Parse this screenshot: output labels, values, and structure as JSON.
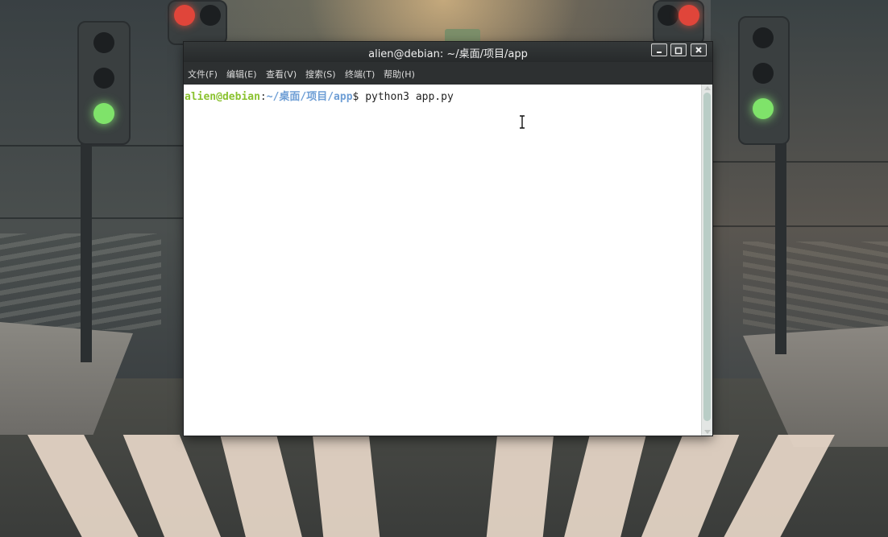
{
  "window": {
    "title": "alien@debian: ~/桌面/项目/app",
    "controls": {
      "minimize_icon": "minimize-icon",
      "maximize_icon": "maximize-icon",
      "close_icon": "close-icon"
    }
  },
  "menubar": {
    "items": [
      {
        "label": "文件(F)"
      },
      {
        "label": "编辑(E)"
      },
      {
        "label": "查看(V)"
      },
      {
        "label": "搜索(S)"
      },
      {
        "label": "终端(T)"
      },
      {
        "label": "帮助(H)"
      }
    ]
  },
  "terminal": {
    "prompt_user": "alien@debian",
    "prompt_sep": ":",
    "prompt_path": "~/桌面/项目/app",
    "prompt_dollar": "$ ",
    "command": "python3 app.py"
  },
  "colors": {
    "prompt_user": "#8ac22f",
    "prompt_path": "#6e9ed5",
    "titlebar": "#2d3031",
    "terminal_bg": "#ffffff"
  }
}
